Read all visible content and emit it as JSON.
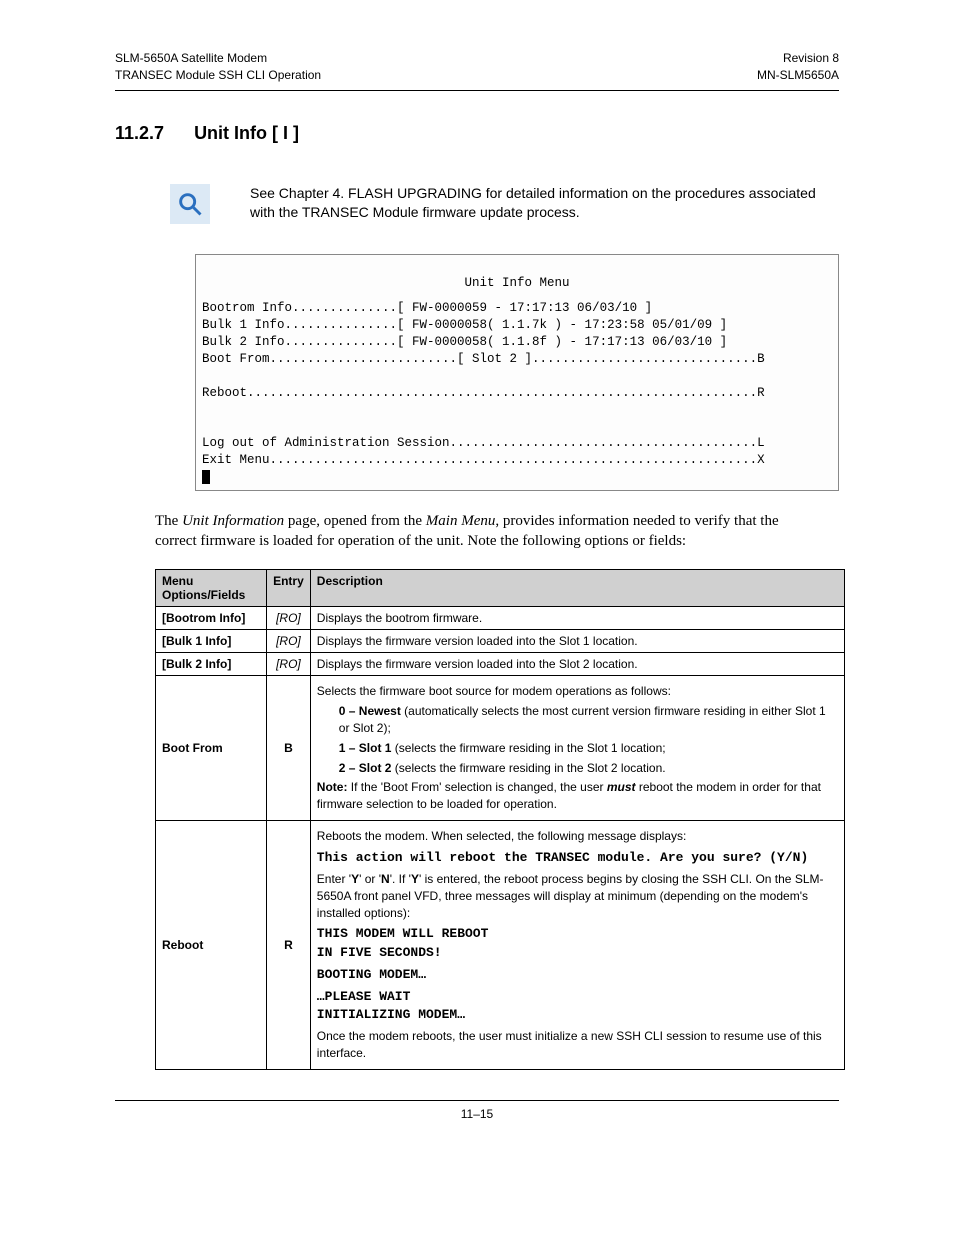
{
  "header": {
    "left1": "SLM-5650A Satellite Modem",
    "left2": "TRANSEC Module SSH CLI Operation",
    "right1": "Revision 8",
    "right2": "MN-SLM5650A"
  },
  "section": {
    "number": "11.2.7",
    "title": "Unit Info [ I ]"
  },
  "info_text": "See Chapter 4. FLASH UPGRADING for detailed information on the procedures associated with the TRANSEC Module firmware update process.",
  "terminal": {
    "title": "Unit Info Menu",
    "lines": [
      "Bootrom Info..............[ FW-0000059 - 17:17:13 06/03/10 ]",
      "Bulk 1 Info...............[ FW-0000058( 1.1.7k ) - 17:23:58 05/01/09 ]",
      "Bulk 2 Info...............[ FW-0000058( 1.1.8f ) - 17:17:13 06/03/10 ]",
      "Boot From.........................[ Slot 2 ]..............................B",
      "",
      "Reboot....................................................................R",
      "",
      "",
      "Log out of Administration Session.........................................L",
      "Exit Menu.................................................................X"
    ]
  },
  "para": {
    "t1": "The ",
    "i1": "Unit Information",
    "t2": " page, opened from the ",
    "i2": "Main Menu",
    "t3": ", provides information needed to verify that the correct firmware is loaded for operation of the unit. Note the following options or fields:"
  },
  "table": {
    "h1": "Menu Options/Fields",
    "h2": "Entry",
    "h3": "Description",
    "rows": {
      "r1": {
        "label": "[Bootrom Info]",
        "entry": "[RO]",
        "desc": "Displays the bootrom firmware."
      },
      "r2": {
        "label": "[Bulk 1 Info]",
        "entry": "[RO]",
        "desc": "Displays the firmware version loaded into the Slot 1 location."
      },
      "r3": {
        "label": "[Bulk 2 Info]",
        "entry": "[RO]",
        "desc": "Displays the firmware version loaded into the Slot 2 location."
      },
      "r4": {
        "label": "Boot From",
        "entry": "B",
        "d1": "Selects the firmware boot source for modem operations as follows:",
        "o0b": "0 – Newest",
        "o0": " (automatically selects the most current version firmware residing in either Slot 1 or Slot 2);",
        "o1b": "1 – Slot 1",
        "o1": " (selects the firmware residing in the Slot 1 location;",
        "o2b": "2 – Slot 2",
        "o2": " (selects the firmware residing in the Slot 2 location.",
        "noteb": "Note:",
        "note1": " If the 'Boot From' selection is changed, the user ",
        "notei": "must",
        "note2": " reboot the modem in order for that firmware selection to be loaded for operation."
      },
      "r5": {
        "label": "Reboot",
        "entry": "R",
        "d1": "Reboots the modem. When selected, the following message displays:",
        "m1": "This action will reboot the TRANSEC module. Are you sure? (Y/N)",
        "d2a": "Enter '",
        "d2b1": "Y",
        "d2b": "' or '",
        "d2b2": "N",
        "d2c": "'. If '",
        "d2b3": "Y",
        "d2d": "' is entered, the reboot process begins by closing the SSH CLI. On the SLM-5650A front panel VFD, three messages will display at minimum (depending on the modem's installed options):",
        "m2": "THIS MODEM WILL REBOOT\nIN FIVE SECONDS!",
        "m3": "BOOTING MODEM…",
        "m4": "…PLEASE WAIT\nINITIALIZING MODEM…",
        "d3": "Once the modem reboots, the user must initialize a new SSH CLI session to resume use of this interface."
      }
    }
  },
  "footer": "11–15"
}
